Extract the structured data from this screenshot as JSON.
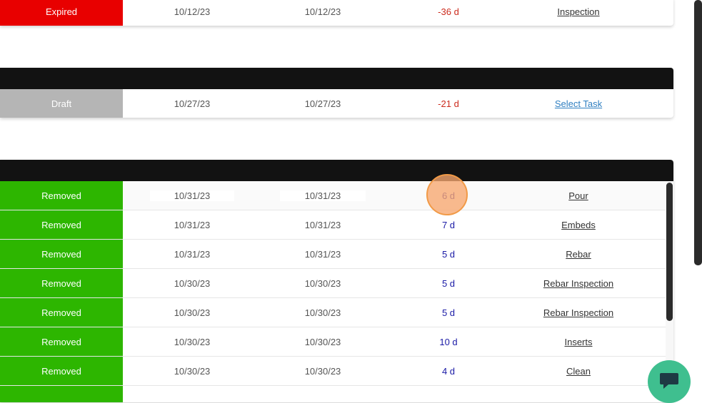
{
  "cards": [
    {
      "rows": [
        {
          "status": "Expired",
          "date_start": "10/12/23",
          "date_end": "10/12/23",
          "days": "-36 d",
          "task": "Inspection"
        }
      ]
    },
    {
      "rows": [
        {
          "status": "Draft",
          "date_start": "10/27/23",
          "date_end": "10/27/23",
          "days": "-21 d",
          "task": "Select Task"
        }
      ]
    },
    {
      "rows": [
        {
          "status": "Removed",
          "date_start": "10/31/23",
          "date_end": "10/31/23",
          "days": "6 d",
          "task": "Pour"
        },
        {
          "status": "Removed",
          "date_start": "10/31/23",
          "date_end": "10/31/23",
          "days": "7 d",
          "task": "Embeds"
        },
        {
          "status": "Removed",
          "date_start": "10/31/23",
          "date_end": "10/31/23",
          "days": "5 d",
          "task": "Rebar"
        },
        {
          "status": "Removed",
          "date_start": "10/30/23",
          "date_end": "10/30/23",
          "days": "5 d",
          "task": "Rebar Inspection"
        },
        {
          "status": "Removed",
          "date_start": "10/30/23",
          "date_end": "10/30/23",
          "days": "5 d",
          "task": "Rebar Inspection"
        },
        {
          "status": "Removed",
          "date_start": "10/30/23",
          "date_end": "10/30/23",
          "days": "10 d",
          "task": "Inserts"
        },
        {
          "status": "Removed",
          "date_start": "10/30/23",
          "date_end": "10/30/23",
          "days": "4 d",
          "task": "Clean"
        }
      ]
    }
  ],
  "colors": {
    "expired": "#e80000",
    "draft": "#b5b5b5",
    "removed": "#2db600",
    "header": "#121212",
    "negative_days": "#cc2b1d",
    "positive_days": "#1a1aa6",
    "chat_button": "#3fbf8f"
  },
  "icons": {
    "chat": "chat-bubble-icon"
  }
}
